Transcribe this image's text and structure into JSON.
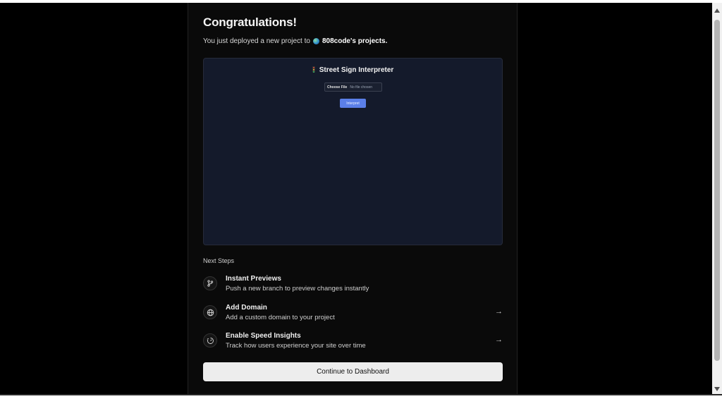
{
  "header": {
    "title": "Congratulations!",
    "subtitle_prefix": "You just deployed a new project to",
    "owner": "808code's projects."
  },
  "preview": {
    "app_title": "Street Sign Interpreter",
    "file_input": {
      "button_label": "Choose File",
      "status": "No file chosen"
    },
    "interpret_label": "Interpret"
  },
  "next_steps": {
    "label": "Next Steps",
    "items": [
      {
        "title": "Instant Previews",
        "description": "Push a new branch to preview changes instantly",
        "icon": "git-branch-icon",
        "has_arrow": false
      },
      {
        "title": "Add Domain",
        "description": "Add a custom domain to your project",
        "icon": "globe-icon",
        "has_arrow": true
      },
      {
        "title": "Enable Speed Insights",
        "description": "Track how users experience your site over time",
        "icon": "speed-gauge-icon",
        "has_arrow": true
      }
    ]
  },
  "continue_label": "Continue to Dashboard",
  "colors": {
    "page_background": "#000000",
    "card_background": "#0a0a0a",
    "preview_background": "#141a2b",
    "interpret_button": "#5b7fe8",
    "primary_button": "#ededed"
  }
}
